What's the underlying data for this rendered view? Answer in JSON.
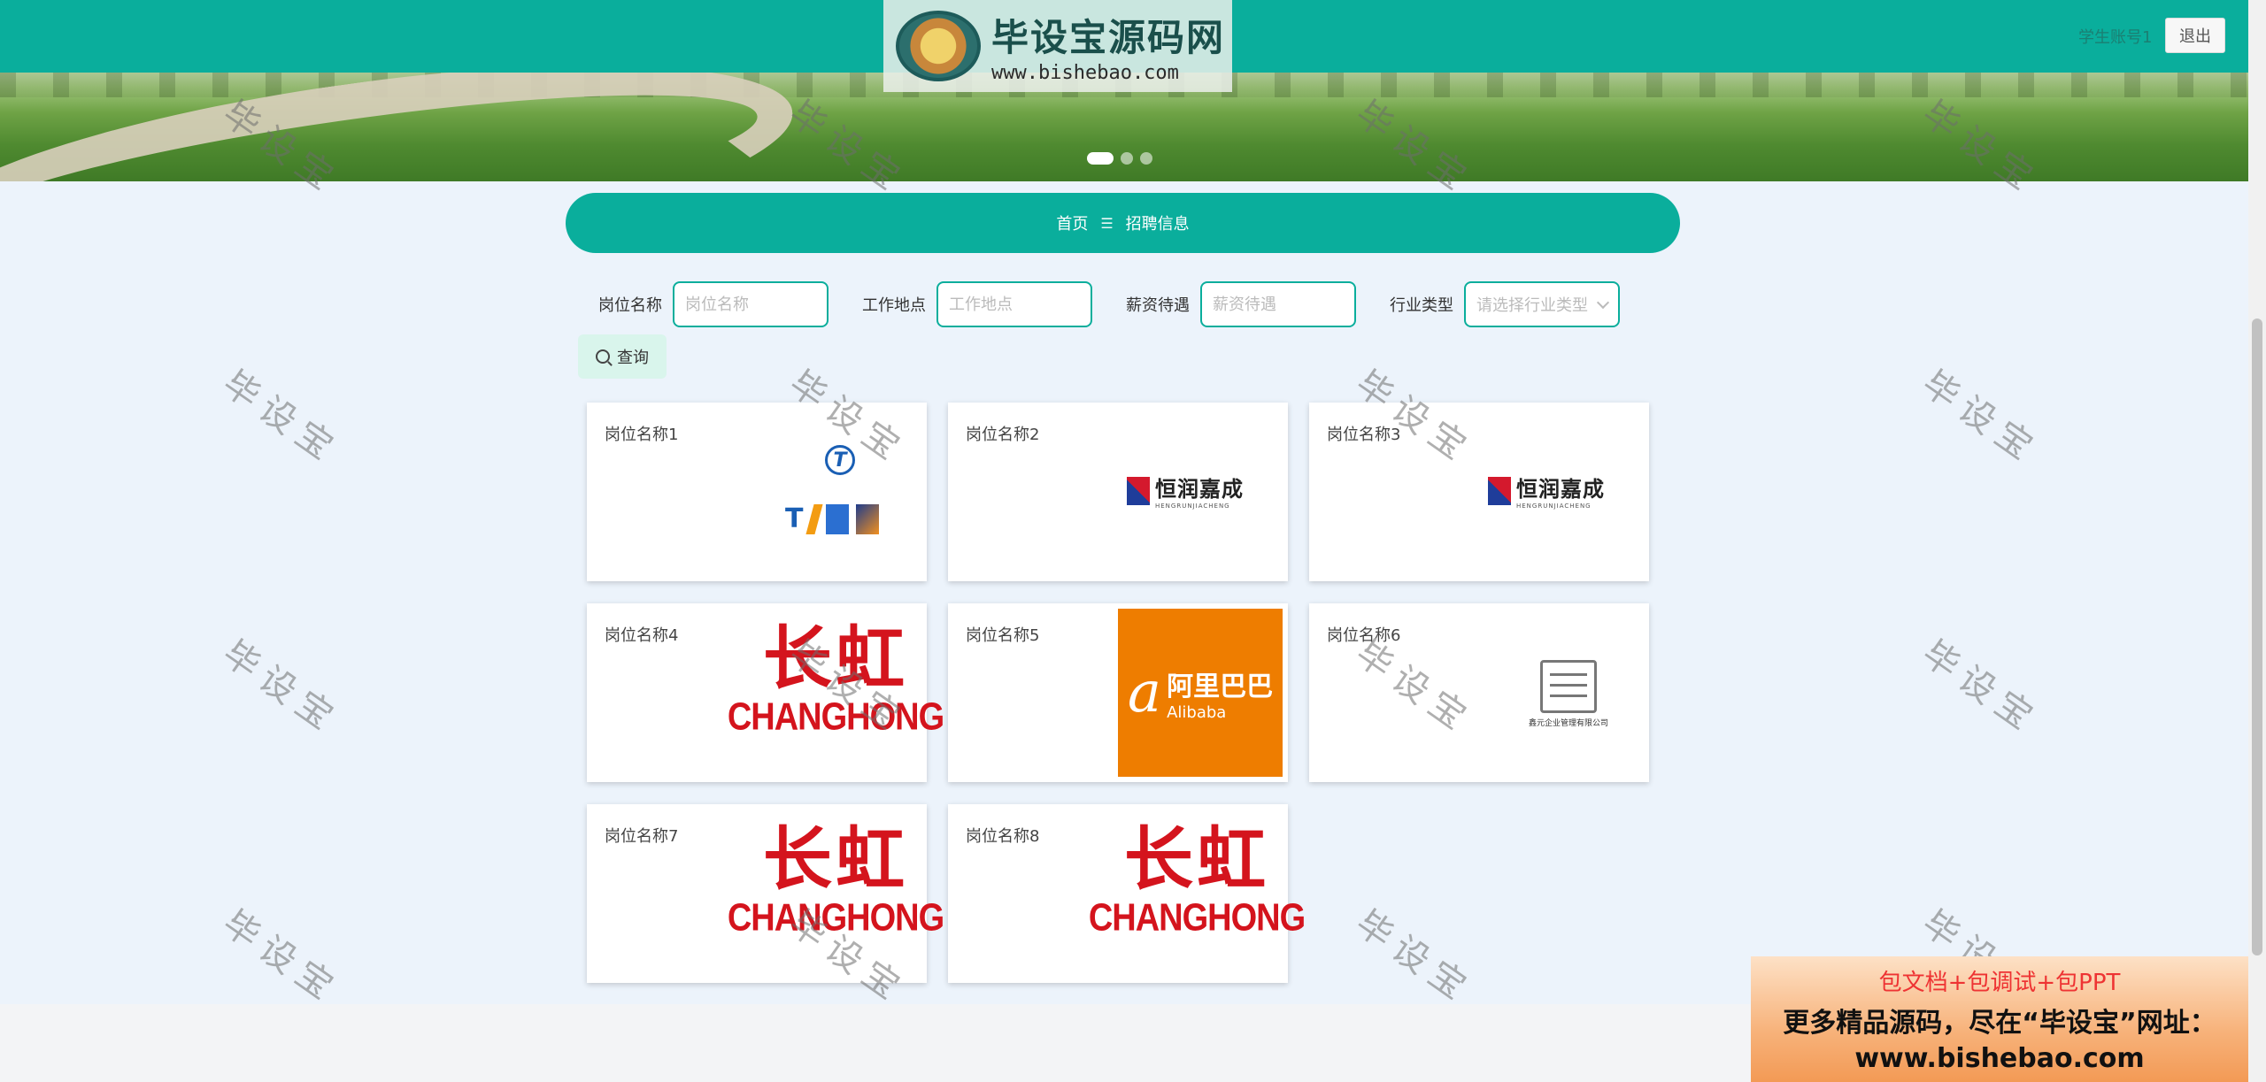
{
  "header": {
    "brand_cn": "毕设宝源码网",
    "brand_url": "www.bishebao.com",
    "user_link": "学生账号1",
    "logout_label": "退出"
  },
  "hero": {
    "slides": 3,
    "active_slide": 1
  },
  "breadcrumb": {
    "home": "首页",
    "separator": "☰",
    "current": "招聘信息"
  },
  "filters": {
    "position_label": "岗位名称",
    "position_placeholder": "岗位名称",
    "location_label": "工作地点",
    "location_placeholder": "工作地点",
    "salary_label": "薪资待遇",
    "salary_placeholder": "薪资待遇",
    "industry_label": "行业类型",
    "industry_placeholder": "请选择行业类型",
    "search_label": "查询"
  },
  "jobs": [
    {
      "title": "岗位名称1",
      "logo": "tt-logo"
    },
    {
      "title": "岗位名称2",
      "logo": "hengrun-logo"
    },
    {
      "title": "岗位名称3",
      "logo": "hengrun-logo"
    },
    {
      "title": "岗位名称4",
      "logo": "changhong-logo"
    },
    {
      "title": "岗位名称5",
      "logo": "alibaba-logo"
    },
    {
      "title": "岗位名称6",
      "logo": "xinyuan-logo"
    },
    {
      "title": "岗位名称7",
      "logo": "changhong-logo"
    },
    {
      "title": "岗位名称8",
      "logo": "changhong-logo"
    }
  ],
  "logos": {
    "tt_mark": "T",
    "tt_t": "T",
    "hengrun_cn": "恒润嘉成",
    "hengrun_en": "HENGRUNJIACHENG",
    "changhong_cn": "长虹",
    "changhong_en": "CHANGHONG",
    "alibaba_mark": "a",
    "alibaba_cn": "阿里巴巴",
    "alibaba_en": "Alibaba",
    "xinyuan_text": "鑫元企业管理有限公司"
  },
  "watermark_text": "毕设宝",
  "promo": {
    "line1": "包文档+包调试+包PPT",
    "line2": "更多精品源码，尽在“毕设宝”网址：",
    "line3": "www.bishebao.com"
  },
  "colors": {
    "primary": "#0aae9c",
    "page_bg": "#ecf3fb",
    "changhong_red": "#d4141d",
    "alibaba_orange": "#ee7d00"
  }
}
